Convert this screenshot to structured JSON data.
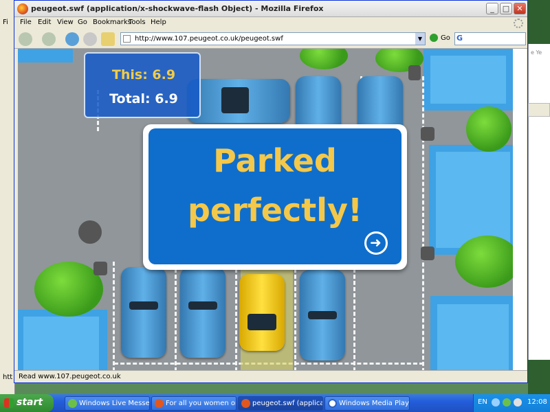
{
  "background_windows": {
    "left_menu_fragment": "Fi",
    "left_status_fragment": "htt",
    "right_fragment": "e Ye"
  },
  "firefox": {
    "title": "peugeot.swf (application/x-shockwave-flash Object) - Mozilla Firefox",
    "menu": [
      "File",
      "Edit",
      "View",
      "Go",
      "Bookmarks",
      "Tools",
      "Help"
    ],
    "url": "http://www.107.peugeot.co.uk/peugeot.swf",
    "go_label": "Go",
    "search_engine": "G",
    "status": "Read www.107.peugeot.co.uk",
    "window_buttons": {
      "minimize": "_",
      "maximize": "□",
      "close": "✕"
    }
  },
  "game": {
    "score_this": "This: 6.9",
    "score_total_label": "Total:",
    "score_total_value": "6.9",
    "message_line1": "Parked",
    "message_line2": "perfectly!",
    "next_icon": "arrow-right-circle-icon"
  },
  "taskbar": {
    "start_label": "start",
    "buttons": [
      {
        "label": "Windows Live Messen...",
        "active": false
      },
      {
        "label": "For all you women or ...",
        "active": false
      },
      {
        "label": "peugeot.swf (applica...",
        "active": true
      },
      {
        "label": "Windows Media Player",
        "active": false
      }
    ],
    "language": "EN",
    "clock": "12:08"
  },
  "colors": {
    "sign_blue": "#0f6ecc",
    "sign_text": "#f4c84a",
    "taskbar_blue": "#245edb"
  }
}
